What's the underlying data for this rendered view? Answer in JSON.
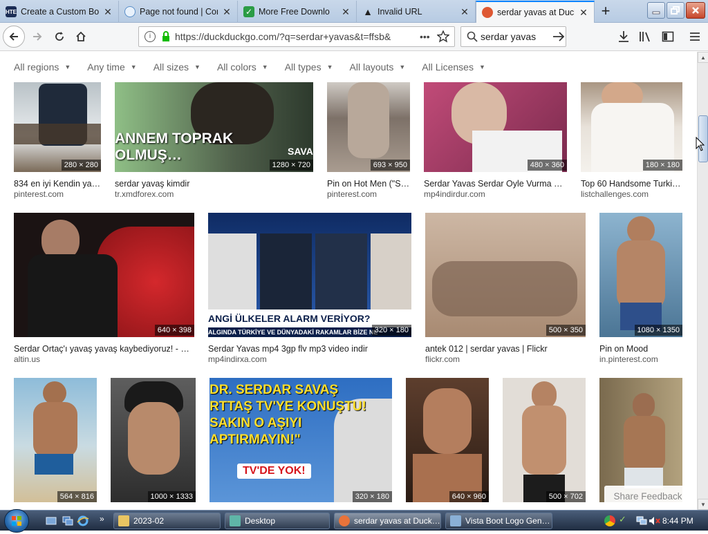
{
  "browser": {
    "tabs": [
      {
        "title": "Create a Custom Boo",
        "favicon": "HTE",
        "active": false
      },
      {
        "title": "Page not found | Cor",
        "favicon": "globe",
        "active": false
      },
      {
        "title": "More Free Downlo",
        "favicon": "check",
        "active": false
      },
      {
        "title": "Invalid URL",
        "favicon": "warning",
        "active": false
      },
      {
        "title": "serdar yavas at DuckD",
        "favicon": "duckduckgo",
        "active": true
      }
    ],
    "url": "https://duckduckgo.com/?q=serdar+yavas&t=ffsb&",
    "search_value": "serdar yavas",
    "url_more": "•••"
  },
  "filters": [
    "All regions",
    "Any time",
    "All sizes",
    "All colors",
    "All types",
    "All layouts",
    "All Licenses"
  ],
  "tiles": [
    {
      "dims": "280 × 280",
      "caption": "834 en iyi Kendin ya…",
      "source": "pinterest.com",
      "color": "#9aa3a8"
    },
    {
      "dims": "1280 × 720",
      "caption": "serdar yavaş kimdir",
      "source": "tr.xmdforex.com",
      "color": "#6c8a63",
      "overlay": "ANNEM TOPRAK\nOLMUŞ…",
      "overlay2": "SAVAŞ"
    },
    {
      "dims": "693 × 950",
      "caption": "Pin on Hot Men (\"S…",
      "source": "pinterest.com",
      "color": "#8b8075"
    },
    {
      "dims": "480 × 360",
      "caption": "Serdar Yavas Serdar Oyle Vurma …",
      "source": "mp4indirdur.com",
      "color": "#a43a62"
    },
    {
      "dims": "180 × 180",
      "caption": "Top 60 Handsome Turki…",
      "source": "listchallenges.com",
      "color": "#c8b8a3"
    },
    {
      "dims": "640 × 398",
      "caption": "Serdar Ortaç'ı yavaş yavaş kaybediyoruz! - …",
      "source": "altin.us",
      "color": "#b3262a"
    },
    {
      "dims": "320 × 180",
      "caption": "Serdar Yavas mp4 3gp flv mp3 video indir",
      "source": "mp4indirxa.com",
      "color": "#1d4d97",
      "overlay": "ANGİ ÜLKELER ALARM VERİYOR?",
      "overlay2": "ALGINDA TÜRKİYE VE DÜNYADAKİ RAKAMLAR BİZE NE"
    },
    {
      "dims": "500 × 350",
      "caption": "antek 012 | serdar yavas | Flickr",
      "source": "flickr.com",
      "color": "#b39a86"
    },
    {
      "dims": "1080 × 1350",
      "caption": "Pin on Mood",
      "source": "in.pinterest.com",
      "color": "#6b98b8"
    },
    {
      "dims": "564 × 816",
      "caption": "",
      "source": "",
      "color": "#6ea3c7"
    },
    {
      "dims": "1000 × 1333",
      "caption": "",
      "source": "",
      "color": "#4a4a4a"
    },
    {
      "dims": "320 × 180",
      "caption": "",
      "source": "",
      "color": "#2f6fc1",
      "overlay": "DR. SERDAR SAVAŞ\nRTTAŞ TV'YE KONUŞTU!\nSAKIN O AŞIYI\nAPTIRMAYIN!\"",
      "overlay2": "TV'DE YOK!"
    },
    {
      "dims": "640 × 960",
      "caption": "",
      "source": "",
      "color": "#8a6a55"
    },
    {
      "dims": "500 × 702",
      "caption": "",
      "source": "",
      "color": "#c9c3bd"
    },
    {
      "dims": "",
      "caption": "",
      "source": "",
      "color": "#8b7a5e"
    }
  ],
  "share_feedback": "Share Feedback",
  "taskbar": {
    "items": [
      {
        "label": "2023-02",
        "active": false
      },
      {
        "label": "Desktop",
        "active": false
      },
      {
        "label": "serdar yavas at Duck…",
        "active": true
      },
      {
        "label": "Vista Boot Logo Gen…",
        "active": false
      }
    ],
    "clock": "8:44 PM"
  },
  "colors": {
    "accent": "#0a84ff",
    "lock_green": "#12bc00",
    "ddg_orange": "#de5833"
  }
}
